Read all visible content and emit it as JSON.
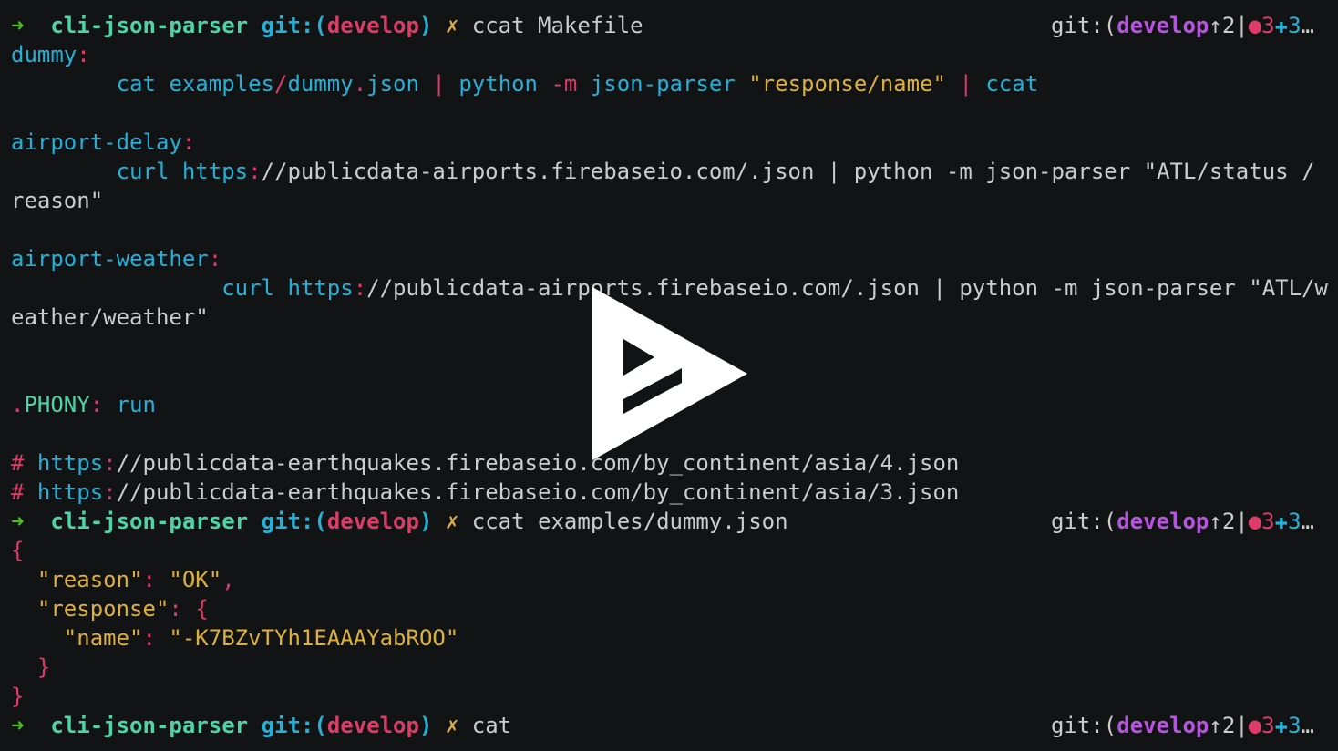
{
  "prompt": {
    "arrow": "➜",
    "dir": "cli-json-parser",
    "git_label": "git:(",
    "branch": "develop",
    "git_close": ")",
    "dirty": "✗"
  },
  "right_status": {
    "git_label": "git:(",
    "branch": "develop",
    "ahead": "↑2",
    "sep": "|",
    "dot": "●3",
    "plus": "✚3",
    "ellipsis": "…"
  },
  "commands": {
    "c1": "ccat Makefile",
    "c2": "ccat examples/dummy.json",
    "c3": "cat"
  },
  "makefile": {
    "t1": "dummy",
    "r1_cat": "cat",
    "r1_examples": "examples",
    "r1_slash": "/",
    "r1_dummy": "dummy",
    "r1_dot": ".",
    "r1_json": "json",
    "r1_pipe1": "|",
    "r1_python": "python",
    "r1_m": "-m",
    "r1_parser": "json-parser",
    "r1_str": "\"response/name\"",
    "r1_pipe2": "|",
    "r1_ccat": "ccat",
    "t2": "airport-delay",
    "r2_curl": "curl",
    "r2_https": "https",
    "r2_rest": "//publicdata-airports.firebaseio.com/.json | python -m json-parser \"ATL/status /",
    "r2_wrap": "reason\"",
    "t3": "airport-weather",
    "r3_curl": "curl",
    "r3_https": "https",
    "r3_rest": "//publicdata-airports.firebaseio.com/.json | python -m json-parser \"ATL/w",
    "r3_wrap": "eather/weather\"",
    "phony": ".PHONY",
    "phony_target": "run",
    "comment1_hash": "#",
    "comment1_https": "https",
    "comment1_rest": "//publicdata-earthquakes.firebaseio.com/by_continent/asia/4.json",
    "comment2_hash": "#",
    "comment2_https": "https",
    "comment2_rest": "//publicdata-earthquakes.firebaseio.com/by_continent/asia/3.json"
  },
  "json_output": {
    "open": "{",
    "k_reason": "\"reason\"",
    "v_reason": "\"OK\"",
    "k_response": "\"response\"",
    "inner_open": "{",
    "k_name": "\"name\"",
    "v_name": "\"-K7BZvTYh1EAAAYabROO\"",
    "inner_close": "}",
    "close": "}"
  },
  "player": {
    "icon": "play-icon"
  }
}
